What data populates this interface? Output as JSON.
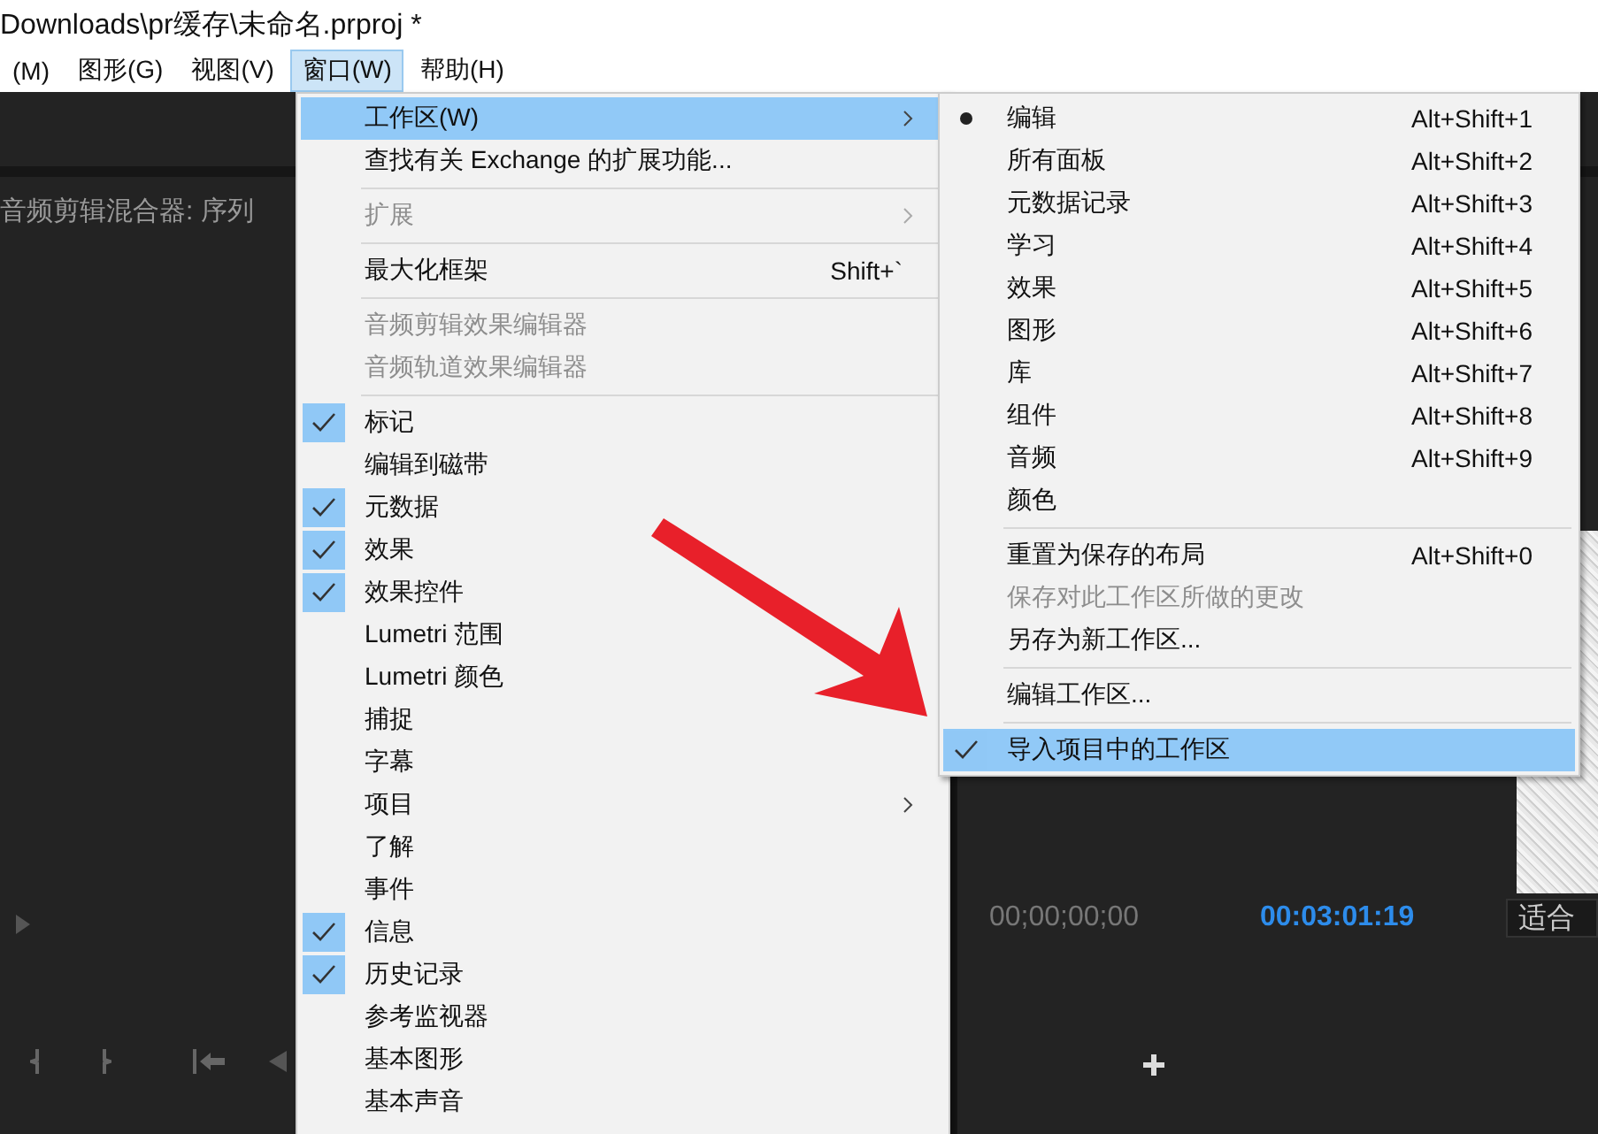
{
  "window": {
    "title": "Downloads\\pr缓存\\未命名.prproj *"
  },
  "menubar": [
    {
      "label": "(M)",
      "selected": false
    },
    {
      "label": "图形(G)",
      "selected": false
    },
    {
      "label": "视图(V)",
      "selected": false
    },
    {
      "label": "窗口(W)",
      "selected": true
    },
    {
      "label": "帮助(H)",
      "selected": false
    }
  ],
  "panel": {
    "title": "音频剪辑混合器: 序列"
  },
  "program_monitor": {
    "timecode_in": "00;00;00;00",
    "timecode_duration": "00:03:01:19",
    "zoom": "适合"
  },
  "window_menu": {
    "items": [
      {
        "kind": "item",
        "label": "工作区(W)",
        "checked": false,
        "disabled": false,
        "selected": true,
        "submenu": true
      },
      {
        "kind": "item",
        "label": "查找有关 Exchange 的扩展功能...",
        "checked": false,
        "disabled": false,
        "selected": false,
        "submenu": false
      },
      {
        "kind": "separator"
      },
      {
        "kind": "item",
        "label": "扩展",
        "checked": false,
        "disabled": true,
        "selected": false,
        "submenu": true
      },
      {
        "kind": "separator"
      },
      {
        "kind": "item",
        "label": "最大化框架",
        "shortcut": "Shift+`",
        "checked": false,
        "disabled": false,
        "selected": false,
        "submenu": false
      },
      {
        "kind": "separator"
      },
      {
        "kind": "item",
        "label": "音频剪辑效果编辑器",
        "checked": false,
        "disabled": true,
        "selected": false,
        "submenu": false
      },
      {
        "kind": "item",
        "label": "音频轨道效果编辑器",
        "checked": false,
        "disabled": true,
        "selected": false,
        "submenu": false
      },
      {
        "kind": "separator"
      },
      {
        "kind": "item",
        "label": "标记",
        "checked": true,
        "disabled": false,
        "selected": false,
        "submenu": false
      },
      {
        "kind": "item",
        "label": "编辑到磁带",
        "checked": false,
        "disabled": false,
        "selected": false,
        "submenu": false
      },
      {
        "kind": "item",
        "label": "元数据",
        "checked": true,
        "disabled": false,
        "selected": false,
        "submenu": false
      },
      {
        "kind": "item",
        "label": "效果",
        "checked": true,
        "disabled": false,
        "selected": false,
        "submenu": false
      },
      {
        "kind": "item",
        "label": "效果控件",
        "checked": true,
        "disabled": false,
        "selected": false,
        "submenu": false
      },
      {
        "kind": "item",
        "label": "Lumetri 范围",
        "checked": false,
        "disabled": false,
        "selected": false,
        "submenu": false
      },
      {
        "kind": "item",
        "label": "Lumetri 颜色",
        "checked": false,
        "disabled": false,
        "selected": false
      },
      {
        "kind": "item",
        "label": "捕捉",
        "checked": false,
        "disabled": false,
        "selected": false,
        "submenu": false
      },
      {
        "kind": "item",
        "label": "字幕",
        "checked": false,
        "disabled": false,
        "selected": false,
        "submenu": false
      },
      {
        "kind": "item",
        "label": "项目",
        "checked": false,
        "disabled": false,
        "selected": false,
        "submenu": true
      },
      {
        "kind": "item",
        "label": "了解",
        "checked": false,
        "disabled": false,
        "selected": false,
        "submenu": false
      },
      {
        "kind": "item",
        "label": "事件",
        "checked": false,
        "disabled": false,
        "selected": false,
        "submenu": false
      },
      {
        "kind": "item",
        "label": "信息",
        "checked": true,
        "disabled": false,
        "selected": false,
        "submenu": false
      },
      {
        "kind": "item",
        "label": "历史记录",
        "checked": true,
        "disabled": false,
        "selected": false,
        "submenu": false
      },
      {
        "kind": "item",
        "label": "参考监视器",
        "checked": false,
        "disabled": false,
        "selected": false,
        "submenu": false
      },
      {
        "kind": "item",
        "label": "基本图形",
        "checked": false,
        "disabled": false,
        "selected": false,
        "submenu": false
      },
      {
        "kind": "item",
        "label": "基本声音",
        "checked": false,
        "disabled": false,
        "selected": false,
        "submenu": false
      }
    ]
  },
  "workspace_submenu": {
    "items": [
      {
        "kind": "radio",
        "label": "编辑",
        "shortcut": "Alt+Shift+1",
        "checked": true,
        "disabled": false,
        "selected": false
      },
      {
        "kind": "radio",
        "label": "所有面板",
        "shortcut": "Alt+Shift+2",
        "checked": false,
        "disabled": false,
        "selected": false
      },
      {
        "kind": "radio",
        "label": "元数据记录",
        "shortcut": "Alt+Shift+3",
        "checked": false,
        "disabled": false,
        "selected": false
      },
      {
        "kind": "radio",
        "label": "学习",
        "shortcut": "Alt+Shift+4",
        "checked": false,
        "disabled": false,
        "selected": false
      },
      {
        "kind": "radio",
        "label": "效果",
        "shortcut": "Alt+Shift+5",
        "checked": false,
        "disabled": false,
        "selected": false
      },
      {
        "kind": "radio",
        "label": "图形",
        "shortcut": "Alt+Shift+6",
        "checked": false,
        "disabled": false,
        "selected": false
      },
      {
        "kind": "radio",
        "label": "库",
        "shortcut": "Alt+Shift+7",
        "checked": false,
        "disabled": false,
        "selected": false
      },
      {
        "kind": "radio",
        "label": "组件",
        "shortcut": "Alt+Shift+8",
        "checked": false,
        "disabled": false,
        "selected": false
      },
      {
        "kind": "radio",
        "label": "音频",
        "shortcut": "Alt+Shift+9",
        "checked": false,
        "disabled": false,
        "selected": false
      },
      {
        "kind": "radio",
        "label": "颜色",
        "checked": false,
        "disabled": false,
        "selected": false
      },
      {
        "kind": "separator"
      },
      {
        "kind": "item",
        "label": "重置为保存的布局",
        "shortcut": "Alt+Shift+0",
        "checked": false,
        "disabled": false,
        "selected": false
      },
      {
        "kind": "item",
        "label": "保存对此工作区所做的更改",
        "checked": false,
        "disabled": true,
        "selected": false
      },
      {
        "kind": "item",
        "label": "另存为新工作区...",
        "checked": false,
        "disabled": false,
        "selected": false
      },
      {
        "kind": "separator"
      },
      {
        "kind": "item",
        "label": "编辑工作区...",
        "checked": false,
        "disabled": false,
        "selected": false
      },
      {
        "kind": "separator"
      },
      {
        "kind": "item",
        "label": "导入项目中的工作区",
        "checked": true,
        "disabled": false,
        "selected": true
      }
    ]
  }
}
